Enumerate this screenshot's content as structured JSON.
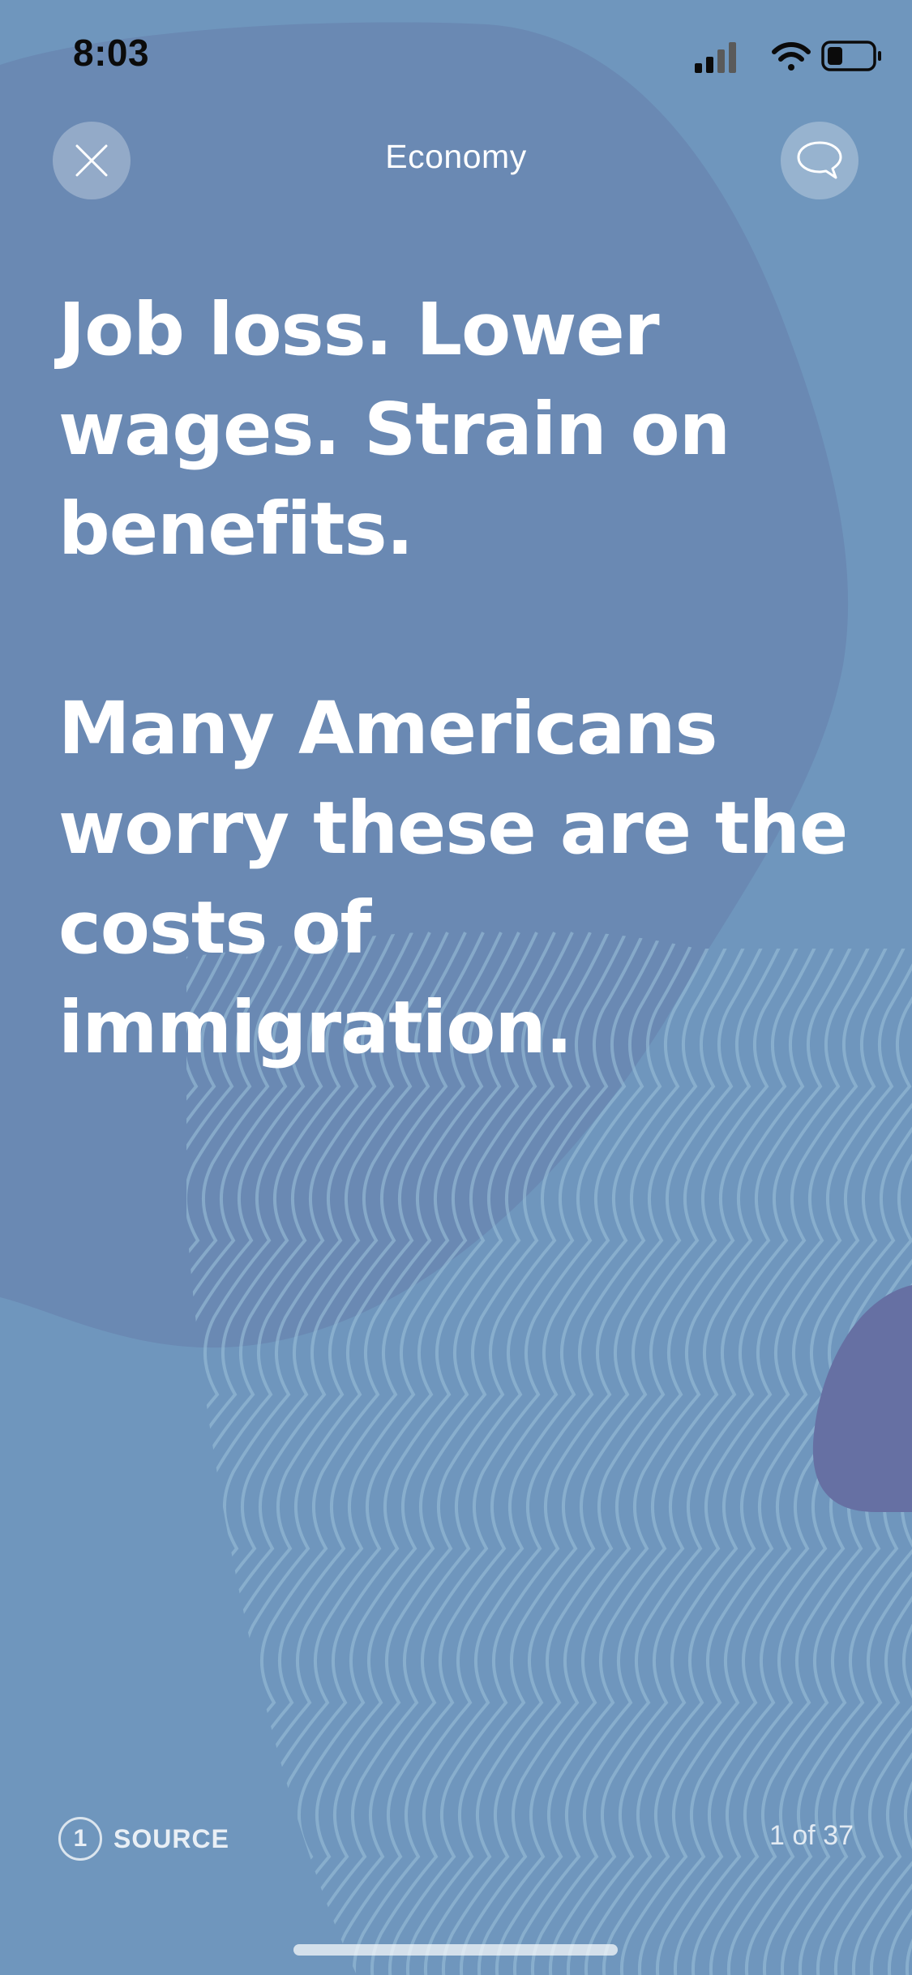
{
  "status_bar": {
    "time": "8:03"
  },
  "header": {
    "title": "Economy",
    "close_icon": "close-icon",
    "comment_icon": "speech-bubble-icon"
  },
  "card": {
    "paragraphs": [
      "Job loss. Lower wages. Strain on benefits.",
      "Many Americans worry these are the costs of immigration."
    ]
  },
  "footer": {
    "source_count": "1",
    "source_label": "SOURCE",
    "page_counter": "1 of 37"
  },
  "colors": {
    "background": "#6f96bd",
    "blob": "#6a89b3",
    "accent_blob": "#6670a3",
    "text": "#ffffff"
  }
}
